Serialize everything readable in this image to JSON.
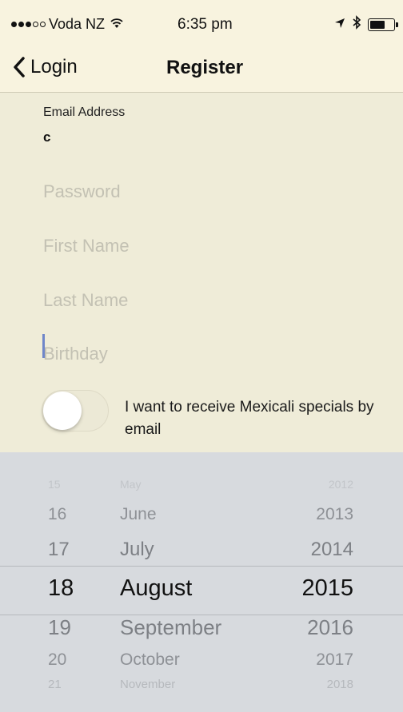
{
  "status_bar": {
    "carrier": "Voda NZ",
    "time": "6:35 pm"
  },
  "nav": {
    "back_label": "Login",
    "title": "Register"
  },
  "form": {
    "email": {
      "label": "Email Address",
      "value": "c"
    },
    "password": {
      "placeholder": "Password"
    },
    "first_name": {
      "placeholder": "First Name"
    },
    "last_name": {
      "placeholder": "Last Name"
    },
    "birthday": {
      "placeholder": "Birthday"
    },
    "newsletter": {
      "label": "I want to receive Mexicali specials by email",
      "on": false
    }
  },
  "picker": {
    "rows": [
      {
        "day": "15",
        "month": "May",
        "year": "2012"
      },
      {
        "day": "16",
        "month": "June",
        "year": "2013"
      },
      {
        "day": "17",
        "month": "July",
        "year": "2014"
      },
      {
        "day": "18",
        "month": "August",
        "year": "2015"
      },
      {
        "day": "19",
        "month": "September",
        "year": "2016"
      },
      {
        "day": "20",
        "month": "October",
        "year": "2017"
      },
      {
        "day": "21",
        "month": "November",
        "year": "2018"
      }
    ],
    "selected_index": 3
  },
  "colors": {
    "header_bg": "#f8f3df",
    "form_bg": "#efecd8",
    "picker_bg": "#d7dade",
    "caret": "#6f86c9"
  }
}
